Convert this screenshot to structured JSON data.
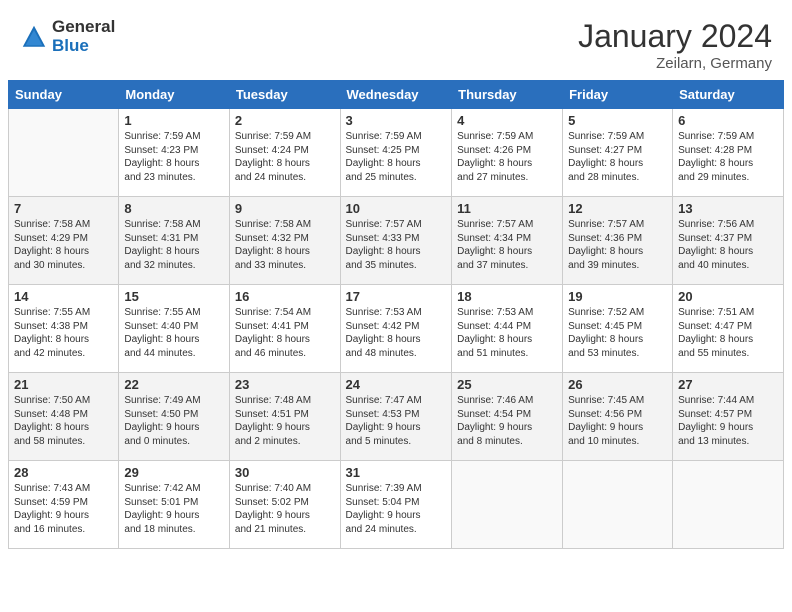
{
  "header": {
    "logo_general": "General",
    "logo_blue": "Blue",
    "month_year": "January 2024",
    "location": "Zeilarn, Germany"
  },
  "days_of_week": [
    "Sunday",
    "Monday",
    "Tuesday",
    "Wednesday",
    "Thursday",
    "Friday",
    "Saturday"
  ],
  "weeks": [
    [
      {
        "day": "",
        "content": ""
      },
      {
        "day": "1",
        "content": "Sunrise: 7:59 AM\nSunset: 4:23 PM\nDaylight: 8 hours\nand 23 minutes."
      },
      {
        "day": "2",
        "content": "Sunrise: 7:59 AM\nSunset: 4:24 PM\nDaylight: 8 hours\nand 24 minutes."
      },
      {
        "day": "3",
        "content": "Sunrise: 7:59 AM\nSunset: 4:25 PM\nDaylight: 8 hours\nand 25 minutes."
      },
      {
        "day": "4",
        "content": "Sunrise: 7:59 AM\nSunset: 4:26 PM\nDaylight: 8 hours\nand 27 minutes."
      },
      {
        "day": "5",
        "content": "Sunrise: 7:59 AM\nSunset: 4:27 PM\nDaylight: 8 hours\nand 28 minutes."
      },
      {
        "day": "6",
        "content": "Sunrise: 7:59 AM\nSunset: 4:28 PM\nDaylight: 8 hours\nand 29 minutes."
      }
    ],
    [
      {
        "day": "7",
        "content": "Sunrise: 7:58 AM\nSunset: 4:29 PM\nDaylight: 8 hours\nand 30 minutes."
      },
      {
        "day": "8",
        "content": "Sunrise: 7:58 AM\nSunset: 4:31 PM\nDaylight: 8 hours\nand 32 minutes."
      },
      {
        "day": "9",
        "content": "Sunrise: 7:58 AM\nSunset: 4:32 PM\nDaylight: 8 hours\nand 33 minutes."
      },
      {
        "day": "10",
        "content": "Sunrise: 7:57 AM\nSunset: 4:33 PM\nDaylight: 8 hours\nand 35 minutes."
      },
      {
        "day": "11",
        "content": "Sunrise: 7:57 AM\nSunset: 4:34 PM\nDaylight: 8 hours\nand 37 minutes."
      },
      {
        "day": "12",
        "content": "Sunrise: 7:57 AM\nSunset: 4:36 PM\nDaylight: 8 hours\nand 39 minutes."
      },
      {
        "day": "13",
        "content": "Sunrise: 7:56 AM\nSunset: 4:37 PM\nDaylight: 8 hours\nand 40 minutes."
      }
    ],
    [
      {
        "day": "14",
        "content": "Sunrise: 7:55 AM\nSunset: 4:38 PM\nDaylight: 8 hours\nand 42 minutes."
      },
      {
        "day": "15",
        "content": "Sunrise: 7:55 AM\nSunset: 4:40 PM\nDaylight: 8 hours\nand 44 minutes."
      },
      {
        "day": "16",
        "content": "Sunrise: 7:54 AM\nSunset: 4:41 PM\nDaylight: 8 hours\nand 46 minutes."
      },
      {
        "day": "17",
        "content": "Sunrise: 7:53 AM\nSunset: 4:42 PM\nDaylight: 8 hours\nand 48 minutes."
      },
      {
        "day": "18",
        "content": "Sunrise: 7:53 AM\nSunset: 4:44 PM\nDaylight: 8 hours\nand 51 minutes."
      },
      {
        "day": "19",
        "content": "Sunrise: 7:52 AM\nSunset: 4:45 PM\nDaylight: 8 hours\nand 53 minutes."
      },
      {
        "day": "20",
        "content": "Sunrise: 7:51 AM\nSunset: 4:47 PM\nDaylight: 8 hours\nand 55 minutes."
      }
    ],
    [
      {
        "day": "21",
        "content": "Sunrise: 7:50 AM\nSunset: 4:48 PM\nDaylight: 8 hours\nand 58 minutes."
      },
      {
        "day": "22",
        "content": "Sunrise: 7:49 AM\nSunset: 4:50 PM\nDaylight: 9 hours\nand 0 minutes."
      },
      {
        "day": "23",
        "content": "Sunrise: 7:48 AM\nSunset: 4:51 PM\nDaylight: 9 hours\nand 2 minutes."
      },
      {
        "day": "24",
        "content": "Sunrise: 7:47 AM\nSunset: 4:53 PM\nDaylight: 9 hours\nand 5 minutes."
      },
      {
        "day": "25",
        "content": "Sunrise: 7:46 AM\nSunset: 4:54 PM\nDaylight: 9 hours\nand 8 minutes."
      },
      {
        "day": "26",
        "content": "Sunrise: 7:45 AM\nSunset: 4:56 PM\nDaylight: 9 hours\nand 10 minutes."
      },
      {
        "day": "27",
        "content": "Sunrise: 7:44 AM\nSunset: 4:57 PM\nDaylight: 9 hours\nand 13 minutes."
      }
    ],
    [
      {
        "day": "28",
        "content": "Sunrise: 7:43 AM\nSunset: 4:59 PM\nDaylight: 9 hours\nand 16 minutes."
      },
      {
        "day": "29",
        "content": "Sunrise: 7:42 AM\nSunset: 5:01 PM\nDaylight: 9 hours\nand 18 minutes."
      },
      {
        "day": "30",
        "content": "Sunrise: 7:40 AM\nSunset: 5:02 PM\nDaylight: 9 hours\nand 21 minutes."
      },
      {
        "day": "31",
        "content": "Sunrise: 7:39 AM\nSunset: 5:04 PM\nDaylight: 9 hours\nand 24 minutes."
      },
      {
        "day": "",
        "content": ""
      },
      {
        "day": "",
        "content": ""
      },
      {
        "day": "",
        "content": ""
      }
    ]
  ]
}
